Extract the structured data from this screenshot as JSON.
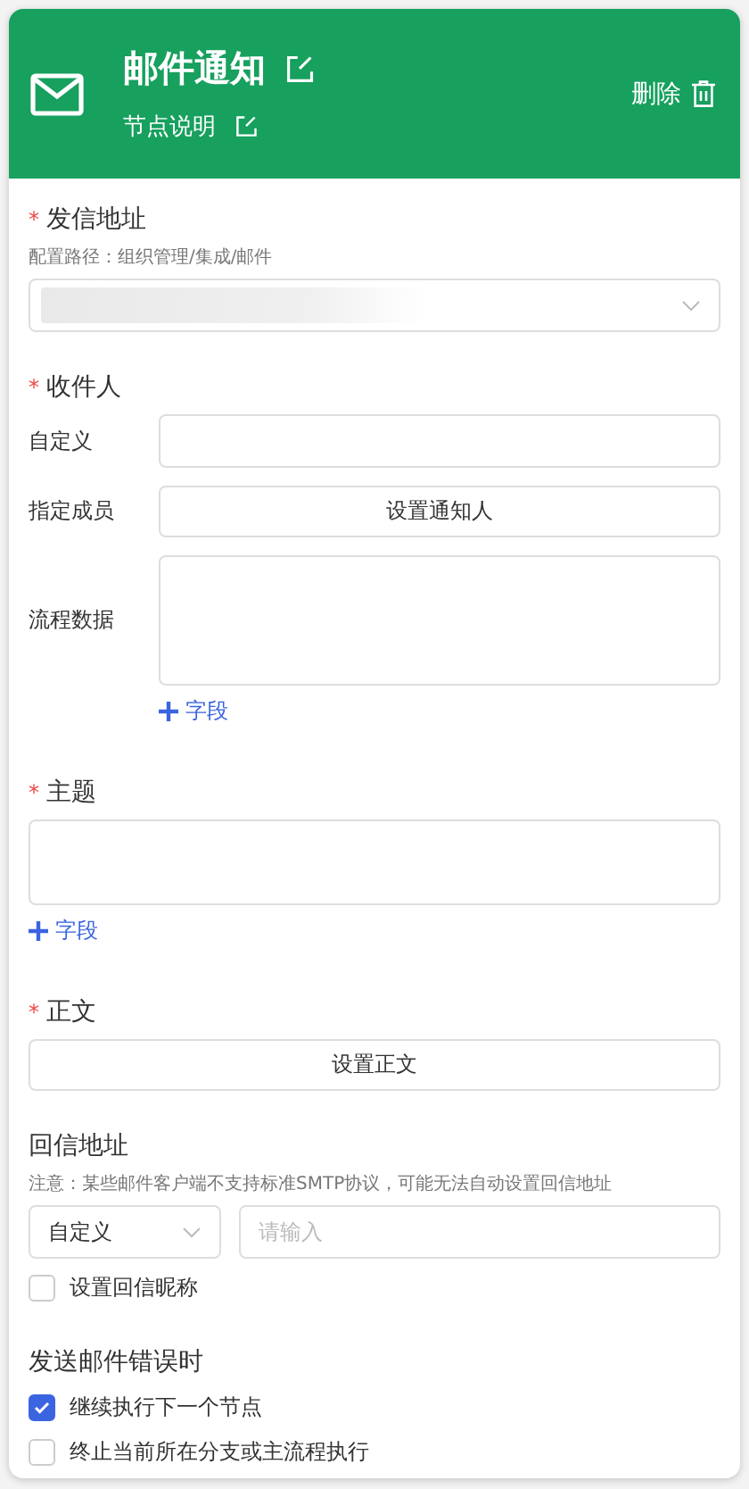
{
  "header": {
    "title": "邮件通知",
    "subtitle": "节点说明",
    "delete_label": "删除"
  },
  "sender": {
    "label": "发信地址",
    "required_mark": "*",
    "hint": "配置路径：组织管理/集成/邮件"
  },
  "recipients": {
    "label": "收件人",
    "required_mark": "*",
    "rows": [
      {
        "kind": "input",
        "label": "自定义"
      },
      {
        "kind": "button",
        "label": "指定成员",
        "button": "设置通知人"
      },
      {
        "kind": "textarea",
        "label": "流程数据",
        "add": "字段"
      }
    ]
  },
  "subject": {
    "label": "主题",
    "required_mark": "*",
    "add": "字段"
  },
  "body": {
    "label": "正文",
    "required_mark": "*",
    "button": "设置正文"
  },
  "reply": {
    "label": "回信地址",
    "note": "注意：某些邮件客户端不支持标准SMTP协议，可能无法自动设置回信地址",
    "select": "自定义",
    "placeholder": "请输入",
    "options": [
      {
        "label": "设置回信昵称",
        "checked": false
      }
    ]
  },
  "on_error": {
    "label": "发送邮件错误时",
    "options": [
      {
        "label": "继续执行下一个节点",
        "checked": true
      },
      {
        "label": "终止当前所在分支或主流程执行",
        "checked": false
      }
    ]
  }
}
